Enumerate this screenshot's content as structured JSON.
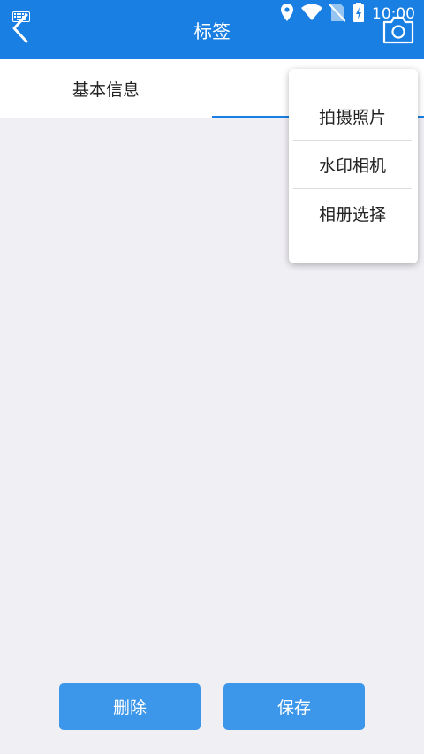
{
  "status_bar": {
    "time": "10:00",
    "icons": [
      "location-icon",
      "wifi-icon",
      "no-sim-icon",
      "battery-charging-icon"
    ]
  },
  "header": {
    "title": "标签",
    "back_icon": "chevron-left-icon",
    "camera_icon": "camera-icon",
    "background_color": "#1a7fe3"
  },
  "tabs": [
    {
      "label": "基本信息",
      "selected": false
    },
    {
      "label": "",
      "selected": true
    }
  ],
  "photo_menu": {
    "items": [
      "拍摄照片",
      "水印相机",
      "相册选择"
    ]
  },
  "actions": {
    "delete_label": "删除",
    "save_label": "保存",
    "button_color": "#3c96ea"
  }
}
